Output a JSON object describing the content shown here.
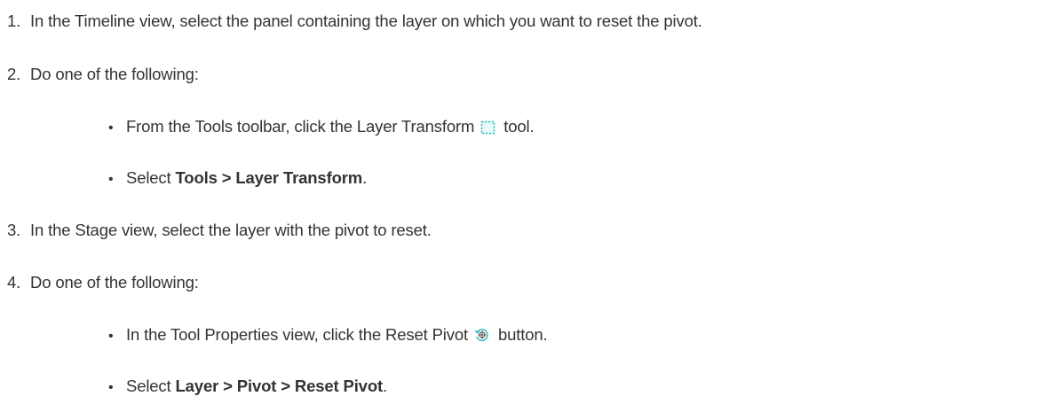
{
  "steps": [
    {
      "number": "1.",
      "text": "In the Timeline view, select the panel containing the layer on which you want to reset the pivot."
    },
    {
      "number": "2.",
      "text": "Do one of the following:",
      "options": [
        {
          "bullet": "•",
          "prefix": "From the Tools toolbar, click the Layer Transform",
          "icon": "layer-transform-icon",
          "suffix": "tool."
        },
        {
          "bullet": "•",
          "prefix": "Select ",
          "bold": "Tools > Layer Transform",
          "suffix": "."
        }
      ]
    },
    {
      "number": "3.",
      "text": "In the Stage view, select the layer with the pivot to reset."
    },
    {
      "number": "4.",
      "text": "Do one of the following:",
      "options": [
        {
          "bullet": "•",
          "prefix": "In the Tool Properties view, click the Reset Pivot",
          "icon": "reset-pivot-icon",
          "suffix": "button."
        },
        {
          "bullet": "•",
          "prefix": "Select ",
          "bold": "Layer > Pivot > Reset Pivot",
          "suffix": "."
        }
      ]
    }
  ],
  "colors": {
    "text": "#333333",
    "icon_accent": "#2bb5b5"
  }
}
